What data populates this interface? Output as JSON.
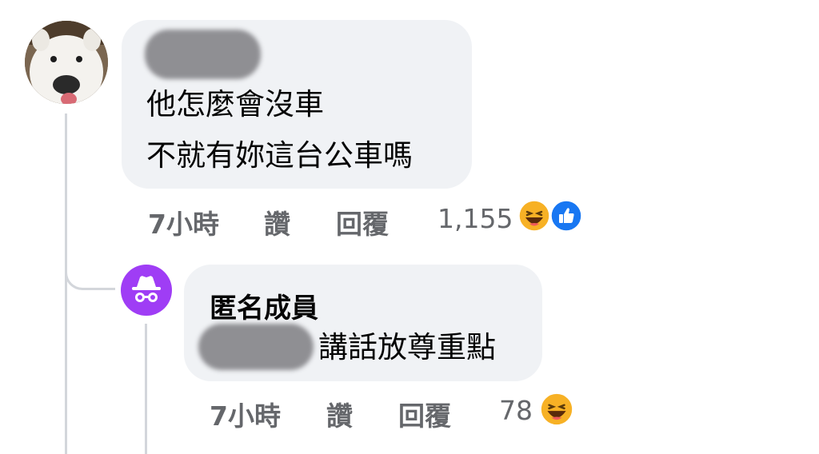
{
  "comment": {
    "lines": [
      "他怎麼會沒車",
      "不就有妳這台公車嗎"
    ],
    "time": "7小時",
    "like_label": "讚",
    "reply_label": "回覆",
    "reaction_count": "1,155",
    "reactions": [
      "haha-icon",
      "like-icon"
    ]
  },
  "reply": {
    "author": "匿名成員",
    "text": "講話放尊重點",
    "time": "7小時",
    "like_label": "讚",
    "reply_label": "回覆",
    "reaction_count": "78",
    "reactions": [
      "haha-icon"
    ]
  },
  "colors": {
    "bubble": "#f0f2f5",
    "meta_text": "#65676b",
    "anon_avatar": "#9f3df5",
    "like_blue": "#1877f2",
    "haha_yellow": "#f7b125"
  }
}
